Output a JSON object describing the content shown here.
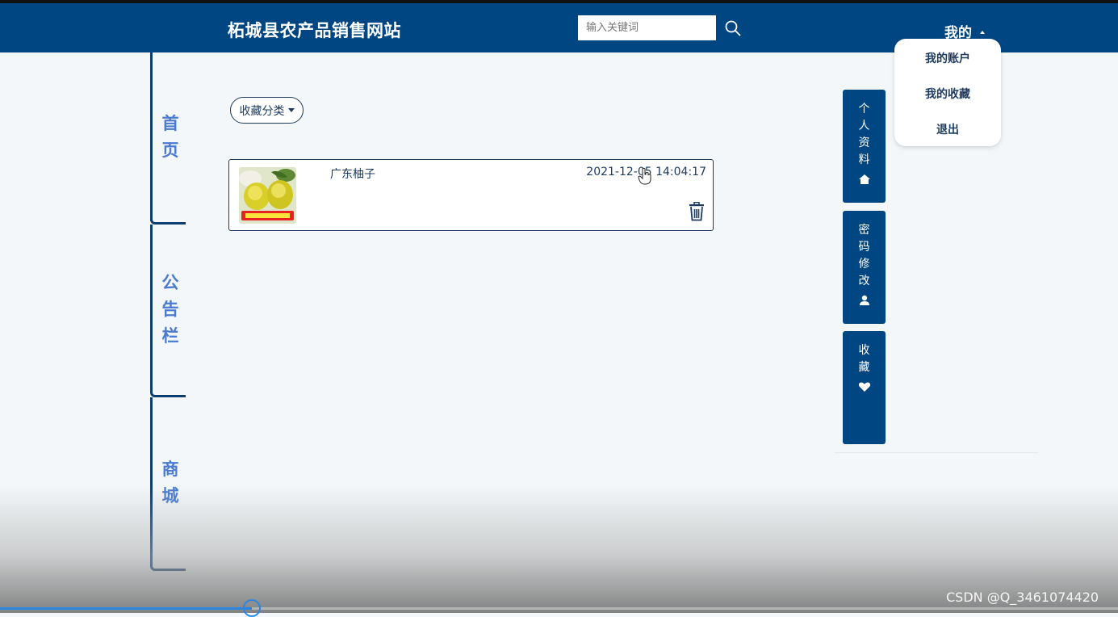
{
  "header": {
    "title": "柘城县农产品销售网站",
    "search_placeholder": "输入关键词",
    "me_label": "我的"
  },
  "dropdown": {
    "items": [
      {
        "label": "我的账户"
      },
      {
        "label": "我的收藏"
      },
      {
        "label": "退出"
      }
    ]
  },
  "left_nav": {
    "items": [
      {
        "label": "首\n页"
      },
      {
        "label": "公\n告\n栏"
      },
      {
        "label": "商\n城"
      }
    ]
  },
  "main": {
    "category_button_label": "收藏分类",
    "favorites": [
      {
        "name": "广东柚子",
        "time": "2021-12-05 14:04:17"
      }
    ]
  },
  "side_panel": {
    "items": [
      {
        "label": "个\n人\n资\n料",
        "icon": "home-icon"
      },
      {
        "label": "密\n码\n修\n改",
        "icon": "user-icon"
      },
      {
        "label": "收\n藏",
        "icon": "heart-icon"
      }
    ]
  },
  "video": {
    "progress": 0.225
  },
  "watermark": "CSDN @Q_3461074420",
  "colors": {
    "header_bg": "#004683",
    "accent": "#004683",
    "nav_text": "#4a7bd0",
    "progress": "#2a86e0"
  }
}
